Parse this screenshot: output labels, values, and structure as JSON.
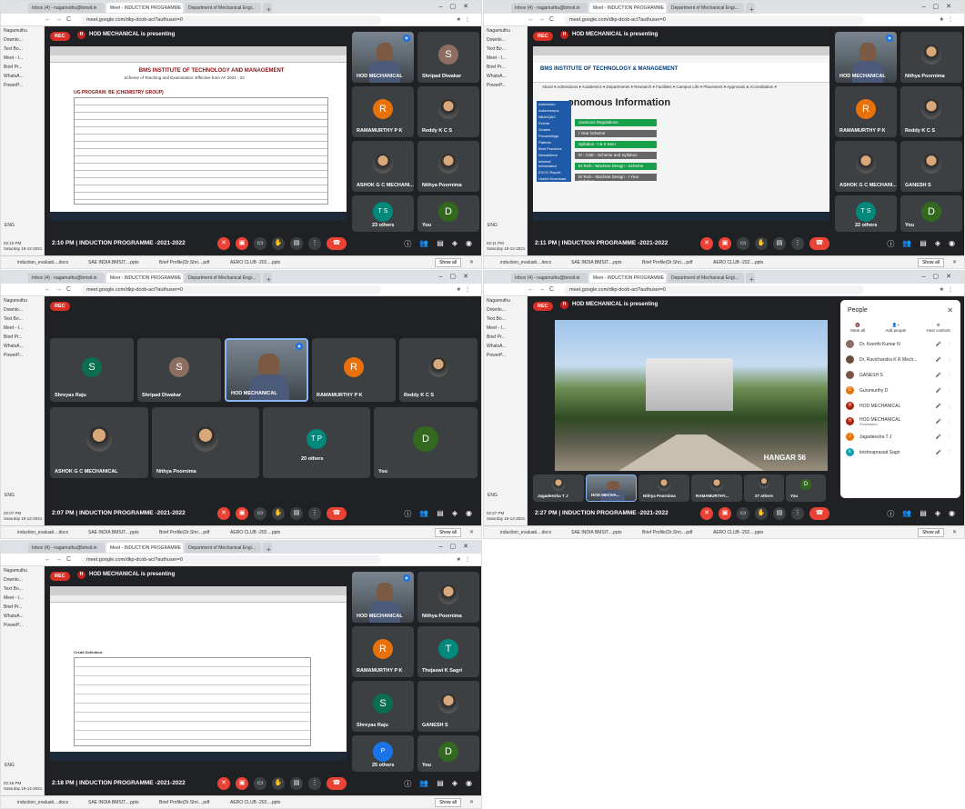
{
  "common": {
    "tabs": [
      "Inbox (4) - nagamuthu@bmsit.in",
      "Meet - INDUCTION PROGRAMME",
      "Department of Mechanical Engi..."
    ],
    "url": "meet.google.com/dkp-dcob-aci?authuser=0",
    "sidebar_items": [
      "Nagamuthu",
      "Downlo...",
      "Text Bo...",
      "Meet - I...",
      "Brief Pr...",
      "WhatsA...",
      "PowerP..."
    ],
    "lang": "ENG",
    "date": "Saturday 18-12-2021",
    "presenting": "HOD MECHANICAL is presenting",
    "rec": "REC",
    "meeting_title": "INDUCTION PROGRAMME -2021-2022",
    "downloads": [
      "induction_evaluati....docx",
      "SAE INDIA BMSIT....pptx",
      "Brief Profile(Dr.Shri....pdf",
      "AERO CLUB -202....pptx"
    ],
    "show_all": "Show all"
  },
  "shots": [
    {
      "time": "2:10 PM",
      "clock": "02:10 PM",
      "doc": {
        "file": "First year scheme.pdf",
        "institute": "BMS INSTITUTE OF TECHNOLOGY AND MANAGEMENT",
        "sub": "Scheme of Teaching and Examination: Effective from AY 2021 - 22",
        "program": "UG PROGRAM: BE (CHEMISTRY GROUP)",
        "semester": "Semester: I"
      },
      "tiles": [
        "HOD MECHANICAL",
        "Shripad Diwakar",
        "RAMAMURTHY P K",
        "Reddy K C S",
        "ASHOK G C MECHANI...",
        "Nithya Poornima",
        "23 others",
        "You"
      ]
    },
    {
      "time": "2:11 PM",
      "clock": "02:11 PM",
      "site": {
        "logo": "BMS INSTITUTE OF TECHNOLOGY & MANAGEMENT",
        "nav": "About ▾   Admissions ▾   Academics ▾   Departments ▾   Research ▾   Facilities ▾   Campus Life ▾   Placement ▾   Approvals & Accreditation ▾",
        "title": "onomous Information",
        "menu": [
          "Admission",
          "Autonomous",
          "NBA/IQAC",
          "Events",
          "Grades",
          "Proceedings",
          "Patents",
          "Best Practices",
          "Newsletters",
          "Internal Information",
          "EXCO Report",
          "Useful Download"
        ],
        "links": [
          "onomous Regulations",
          "I Year Scheme",
          "Syllabus - I & II Sem",
          "III - CSE - Scheme and Syllabus",
          "M.Tech - Machine Design - Scheme",
          "M.Tech - Machine Design - I Year Syllabus"
        ]
      },
      "tiles": [
        "HOD MECHANICAL",
        "Nithya Poornima",
        "RAMAMURTHY P K",
        "Reddy K C S",
        "ASHOK G C MECHANI...",
        "GANESH S",
        "22 others",
        "You"
      ]
    },
    {
      "time": "2:07 PM",
      "clock": "02:07 PM",
      "tiles": [
        "Shreyas Raju",
        "Shripad Diwakar",
        "HOD MECHANICAL",
        "RAMAMURTHY P K",
        "Reddy K C S",
        "ASHOK G C MECHANICAL",
        "Nithya Poornima",
        "20 others",
        "You"
      ]
    },
    {
      "time": "2:27 PM",
      "clock": "02:27 PM",
      "campus_tag": "HANGAR 56",
      "strip": [
        "Jagadeesha T J",
        "HOD MECHA...",
        "Nithya Poornima",
        "RAMAMURTHY...",
        "27 others",
        "You"
      ],
      "people": {
        "title": "People",
        "actions": [
          "Mute all",
          "Add people",
          "Host controls"
        ],
        "list": [
          {
            "name": "Dr. Keerthi Kumar N",
            "sub": "",
            "color": "#8d6e63",
            "initial": ""
          },
          {
            "name": "Dr. Ravichandra K R Mech...",
            "sub": "",
            "color": "#6d4c41",
            "initial": ""
          },
          {
            "name": "GANESH S",
            "sub": "",
            "color": "#795548",
            "initial": ""
          },
          {
            "name": "Gurumurthy D",
            "sub": "",
            "color": "#e8710a",
            "initial": "G"
          },
          {
            "name": "HOD MECHANICAL",
            "sub": "",
            "color": "#a52714",
            "initial": "H"
          },
          {
            "name": "HOD MECHANICAL",
            "sub": "Presentation",
            "color": "#a52714",
            "initial": "H"
          },
          {
            "name": "Jagadeesha T J",
            "sub": "",
            "color": "#e8710a",
            "initial": "J"
          },
          {
            "name": "krishnaprasad Sagri",
            "sub": "",
            "color": "#129eaf",
            "initial": "k"
          }
        ]
      }
    },
    {
      "time": "2:18 PM",
      "clock": "02:18 PM",
      "doc": {
        "file": "First year scheme.pdf",
        "credit": "Credit Definition:"
      },
      "tiles": [
        "HOD MECHANICAL",
        "Nithya Poornima",
        "RAMAMURTHY P K",
        "Thejaswi K Sagri",
        "Shreyas Raju",
        "GANESH S",
        "25 others",
        "You"
      ]
    }
  ]
}
